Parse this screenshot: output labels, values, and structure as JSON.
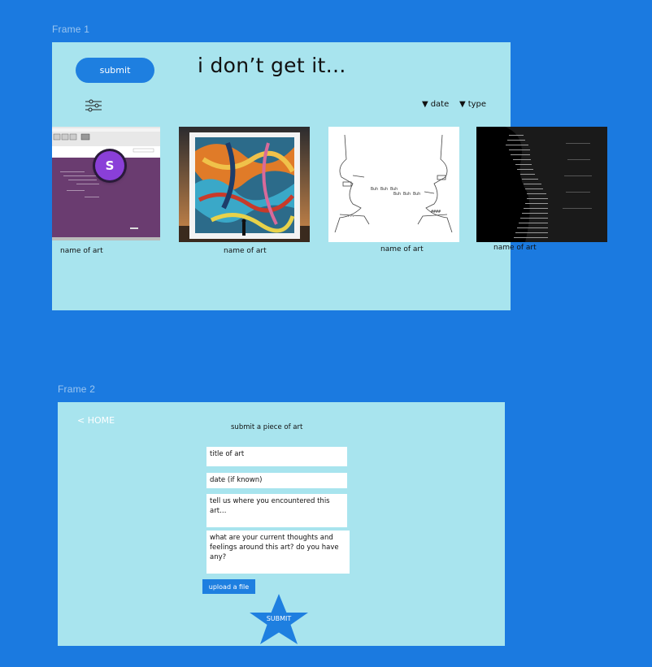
{
  "frame1": {
    "label": "Frame 1",
    "submit_label": "submit",
    "headline": "i don’t get it…",
    "sort_date": "date",
    "sort_type": "type",
    "avatar_initial": "S",
    "captions": [
      "name of art",
      "name of art",
      "name of art",
      "name of art"
    ]
  },
  "frame2": {
    "label": "Frame 2",
    "home_link": "< HOME",
    "form_title": "submit a piece of art",
    "fields": {
      "title": "title of art",
      "date": "date (if known)",
      "where": "tell us where you encountered this art…",
      "thoughts": "what are your current thoughts and feelings around this art? do you have any?"
    },
    "upload_label": "upload a file",
    "submit_label": "SUBMIT"
  },
  "colors": {
    "canvas": "#1b7ae0",
    "frame": "#a8e4ee",
    "button": "#1e7fe0",
    "avatar": "#8a3fd8"
  }
}
